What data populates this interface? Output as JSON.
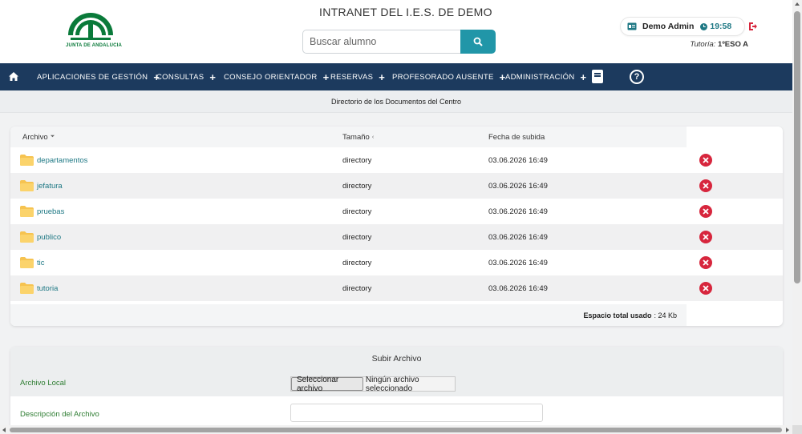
{
  "header": {
    "logo_text": "JUNTA DE ANDALUCIA",
    "site_title": "INTRANET DEL I.E.S. DE DEMO",
    "search": {
      "placeholder": "Buscar alumno"
    },
    "user": {
      "name": "Demo Admin",
      "time": "19:58"
    },
    "tutoria_label": "Tutoría:",
    "tutoria_value": "1ºESO A"
  },
  "navbar": {
    "items": [
      {
        "label": "APLICACIONES DE GESTIÓN",
        "icon": "plus"
      },
      {
        "label": "CONSULTAS",
        "icon": "plus"
      },
      {
        "label": "CONSEJO ORIENTADOR",
        "icon": "plus"
      },
      {
        "label": "RESERVAS",
        "icon": "plus"
      },
      {
        "label": "PROFESORADO AUSENTE",
        "icon": "plus"
      },
      {
        "label": "ADMINISTRACIÓN",
        "icon": "plus"
      }
    ],
    "plus": "+",
    "help": "?"
  },
  "page": {
    "subtitle": "Directorio de los Documentos del Centro"
  },
  "table": {
    "headers": {
      "file": "Archivo",
      "size": "Tamaño",
      "date": "Fecha de subida"
    },
    "rows": [
      {
        "name": "departamentos",
        "size": "directory",
        "date": "03.06.2026 16:49"
      },
      {
        "name": "jefatura",
        "size": "directory",
        "date": "03.06.2026 16:49"
      },
      {
        "name": "pruebas",
        "size": "directory",
        "date": "03.06.2026 16:49"
      },
      {
        "name": "publico",
        "size": "directory",
        "date": "03.06.2026 16:49"
      },
      {
        "name": "tic",
        "size": "directory",
        "date": "03.06.2026 16:49"
      },
      {
        "name": "tutoria",
        "size": "directory",
        "date": "03.06.2026 16:49"
      }
    ],
    "total_label": "Espacio total usado",
    "total_value": ": 24 Kb"
  },
  "upload": {
    "title": "Subir Archivo",
    "local_label": "Archivo Local",
    "file_button": "Seleccionar archivo",
    "file_status": "Ningún archivo seleccionado",
    "desc_label": "Descripción del Archivo"
  },
  "colors": {
    "navbar": "#1c3a5e",
    "accent": "#2196a8",
    "link": "#1e7884",
    "label_green": "#2e7d32",
    "delete_red": "#d7263d",
    "folder": "#f6c350"
  }
}
